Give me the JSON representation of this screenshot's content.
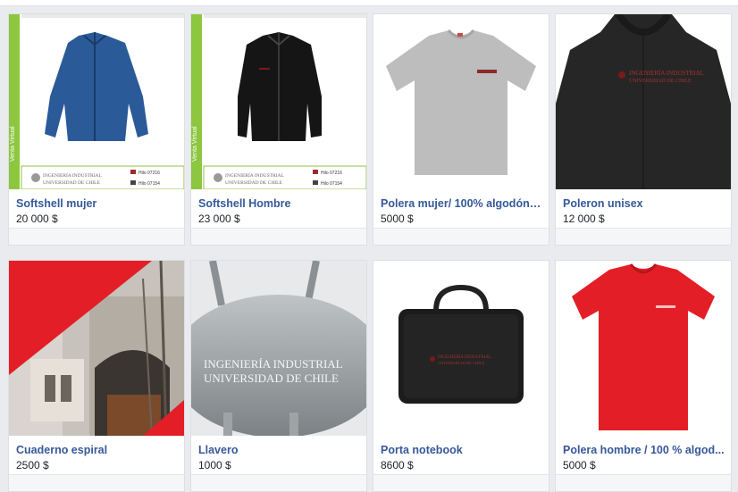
{
  "products": [
    {
      "name": "Softshell mujer",
      "price": "20 000 $",
      "logo_line1": "INGENIERÍA INDUSTRIAL",
      "logo_line2": "UNIVERSIDAD DE CHILE",
      "color1": "Hilo 07216",
      "color2": "Hilo 07154",
      "side_text": "Venta Virtual"
    },
    {
      "name": "Softshell Hombre",
      "price": "23 000 $",
      "logo_line1": "INGENIERÍA INDUSTRIAL",
      "logo_line2": "UNIVERSIDAD DE CHILE",
      "color1": "Hilo 07216",
      "color2": "Hilo 07154",
      "side_text": "Venta Virtual"
    },
    {
      "name": "Polera mujer/ 100% algodón /...",
      "price": "5000 $"
    },
    {
      "name": "Poleron unisex",
      "price": "12 000 $",
      "logo_line1": "INGENIERÍA INDUSTRIAL",
      "logo_line2": "UNIVERSIDAD DE CHILE"
    },
    {
      "name": "Cuaderno espiral",
      "price": "2500 $"
    },
    {
      "name": "Llavero",
      "price": "1000 $",
      "logo_line1": "INGENIERÍA INDUSTRIAL",
      "logo_line2": "UNIVERSIDAD DE CHILE"
    },
    {
      "name": "Porta notebook",
      "price": "8600 $",
      "logo_line1": "INGENIERÍA INDUSTRIAL",
      "logo_line2": "UNIVERSIDAD DE CHILE"
    },
    {
      "name": "Polera hombre / 100 % algod...",
      "price": "5000 $"
    }
  ],
  "colors": {
    "link": "#365899",
    "softshell_blue": "#2b5a99",
    "accent_green": "#8dc63f",
    "brand_red": "#e41e26"
  }
}
